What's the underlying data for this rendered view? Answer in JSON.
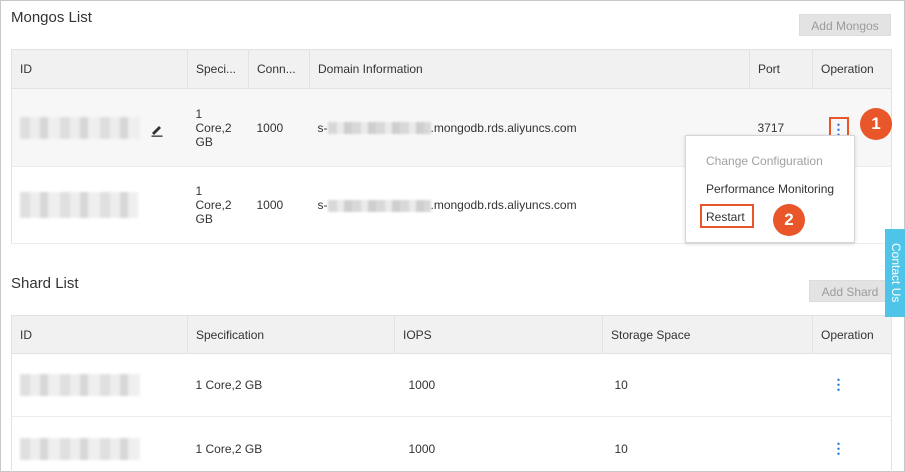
{
  "mongos": {
    "title": "Mongos List",
    "add_button": "Add Mongos",
    "columns": [
      "ID",
      "Speci...",
      "Conn...",
      "Domain Information",
      "Port",
      "Operation"
    ],
    "rows": [
      {
        "spec_lines": [
          "1",
          "Core,2",
          "GB"
        ],
        "connections": "1000",
        "domain_prefix": "s-",
        "domain_suffix": ".mongodb.rds.aliyuncs.com",
        "port": "3717",
        "operation": "⋮"
      },
      {
        "spec_lines": [
          "1",
          "Core,2",
          "GB"
        ],
        "connections": "1000",
        "domain_prefix": "s-",
        "domain_suffix": ".mongodb.rds.aliyuncs.com",
        "port": "",
        "operation": ""
      }
    ]
  },
  "menu": {
    "items": [
      "Change Configuration",
      "Performance Monitoring",
      "Restart"
    ]
  },
  "badges": [
    "1",
    "2"
  ],
  "shard": {
    "title": "Shard List",
    "add_button": "Add Shard",
    "columns": [
      "ID",
      "Specification",
      "IOPS",
      "Storage Space",
      "Operation"
    ],
    "rows": [
      {
        "spec": "1 Core,2 GB",
        "iops": "1000",
        "storage": "10",
        "operation": "⋮"
      },
      {
        "spec": "1 Core,2 GB",
        "iops": "1000",
        "storage": "10",
        "operation": "⋮"
      }
    ]
  },
  "contact": "Contact Us",
  "colors": {
    "accent_orange": "#e8562a",
    "link_blue": "#0f6fd7",
    "contact_bg": "#4ec5e8"
  },
  "icons": {
    "edit": "edit-icon",
    "more": "more-vertical-icon"
  }
}
